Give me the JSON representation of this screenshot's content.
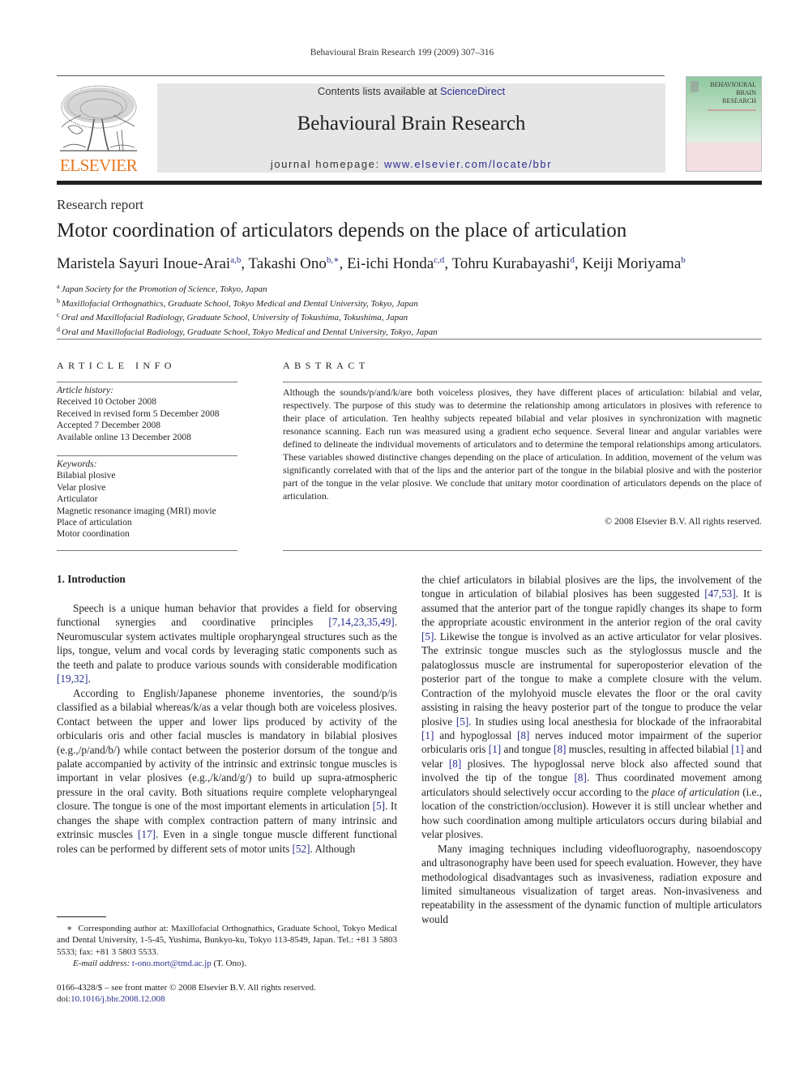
{
  "running_head": "Behavioural Brain Research 199 (2009) 307–316",
  "header": {
    "publisher_logo_text": "ELSEVIER",
    "contents_prefix": "Contents lists available at ",
    "contents_link": "ScienceDirect",
    "journal_name": "Behavioural Brain Research",
    "homepage_prefix": "journal homepage: ",
    "homepage_link": "www.elsevier.com/locate/bbr",
    "cover_title_lines": [
      "BEHAVIOURAL",
      "BRAIN",
      "RESEARCH"
    ],
    "colors": {
      "publisher_orange": "#e87722",
      "link_blue": "#2a2f8f",
      "banner_gray": "#e6e6e7"
    }
  },
  "article": {
    "type": "Research report",
    "title": "Motor coordination of articulators depends on the place of articulation",
    "authors": [
      {
        "name": "Maristela Sayuri Inoue-Arai",
        "sup": "a,b"
      },
      {
        "name": "Takashi Ono",
        "sup": "b,∗"
      },
      {
        "name": "Ei-ichi Honda",
        "sup": "c,d"
      },
      {
        "name": "Tohru Kurabayashi",
        "sup": "d"
      },
      {
        "name": "Keiji Moriyama",
        "sup": "b"
      }
    ],
    "affiliations": [
      {
        "key": "a",
        "text": "Japan Society for the Promotion of Science, Tokyo, Japan"
      },
      {
        "key": "b",
        "text": "Maxillofacial Orthognathics, Graduate School, Tokyo Medical and Dental University, Tokyo, Japan"
      },
      {
        "key": "c",
        "text": "Oral and Maxillofacial Radiology, Graduate School, University of Tokushima, Tokushima, Japan"
      },
      {
        "key": "d",
        "text": "Oral and Maxillofacial Radiology, Graduate School, Tokyo Medical and Dental University, Tokyo, Japan"
      }
    ]
  },
  "article_info": {
    "heading": "ARTICLE INFO",
    "history_label": "Article history:",
    "history": [
      "Received 10 October 2008",
      "Received in revised form 5 December 2008",
      "Accepted 7 December 2008",
      "Available online 13 December 2008"
    ],
    "keywords_label": "Keywords:",
    "keywords": [
      "Bilabial plosive",
      "Velar plosive",
      "Articulator",
      "Magnetic resonance imaging (MRI) movie",
      "Place of articulation",
      "Motor coordination"
    ]
  },
  "abstract": {
    "heading": "ABSTRACT",
    "text": "Although the sounds/p/and/k/are both voiceless plosives, they have different places of articulation: bilabial and velar, respectively. The purpose of this study was to determine the relationship among articulators in plosives with reference to their place of articulation. Ten healthy subjects repeated bilabial and velar plosives in synchronization with magnetic resonance scanning. Each run was measured using a gradient echo sequence. Several linear and angular variables were defined to delineate the individual movements of articulators and to determine the temporal relationships among articulators. These variables showed distinctive changes depending on the place of articulation. In addition, movement of the velum was significantly correlated with that of the lips and the anterior part of the tongue in the bilabial plosive and with the posterior part of the tongue in the velar plosive. We conclude that unitary motor coordination of articulators depends on the place of articulation.",
    "copyright": "© 2008 Elsevier B.V. All rights reserved."
  },
  "introduction": {
    "heading": "1.  Introduction",
    "left_column": [
      {
        "indent": true,
        "segments": [
          {
            "t": "Speech is a unique human behavior that provides a field for observing functional synergies and coordinative principles "
          },
          {
            "t": "[7,14,23,35,49]",
            "ref": true
          },
          {
            "t": ". Neuromuscular system activates multiple oropharyngeal structures such as the lips, tongue, velum and vocal cords by leveraging static components such as the teeth and palate to produce various sounds with considerable modification "
          },
          {
            "t": "[19,32]",
            "ref": true
          },
          {
            "t": "."
          }
        ]
      },
      {
        "indent": true,
        "segments": [
          {
            "t": "According to English/Japanese phoneme inventories, the sound/p/is classified as a bilabial whereas/k/as a velar though both are voiceless plosives. Contact between the upper and lower lips produced by activity of the orbicularis oris and other facial muscles is mandatory in bilabial plosives (e.g.,/p/and/b/) while contact between the posterior dorsum of the tongue and palate accompanied by activity of the intrinsic and extrinsic tongue muscles is important in velar plosives (e.g.,/k/and/g/) to build up supra-atmospheric pressure in the oral cavity. Both situations require complete velopharyngeal closure. The tongue is one of the most important elements in articulation "
          },
          {
            "t": "[5]",
            "ref": true
          },
          {
            "t": ". It changes the shape with complex contraction pattern of many intrinsic and extrinsic muscles "
          },
          {
            "t": "[17]",
            "ref": true
          },
          {
            "t": ". Even in a single tongue muscle different functional roles can be performed by different sets of motor units "
          },
          {
            "t": "[52]",
            "ref": true
          },
          {
            "t": ". Although"
          }
        ]
      }
    ],
    "right_column": [
      {
        "indent": false,
        "segments": [
          {
            "t": "the chief articulators in bilabial plosives are the lips, the involvement of the tongue in articulation of bilabial plosives has been suggested "
          },
          {
            "t": "[47,53]",
            "ref": true
          },
          {
            "t": ". It is assumed that the anterior part of the tongue rapidly changes its shape to form the appropriate acoustic environment in the anterior region of the oral cavity "
          },
          {
            "t": "[5]",
            "ref": true
          },
          {
            "t": ". Likewise the tongue is involved as an active articulator for velar plosives. The extrinsic tongue muscles such as the styloglossus muscle and the palatoglossus muscle are instrumental for superoposterior elevation of the posterior part of the tongue to make a complete closure with the velum. Contraction of the mylohyoid muscle elevates the floor or the oral cavity assisting in raising the heavy posterior part of the tongue to produce the velar plosive "
          },
          {
            "t": "[5]",
            "ref": true
          },
          {
            "t": ". In studies using local anesthesia for blockade of the infraorabital "
          },
          {
            "t": "[1]",
            "ref": true
          },
          {
            "t": " and hypoglossal "
          },
          {
            "t": "[8]",
            "ref": true
          },
          {
            "t": " nerves induced motor impairment of the superior orbicularis oris "
          },
          {
            "t": "[1]",
            "ref": true
          },
          {
            "t": " and tongue "
          },
          {
            "t": "[8]",
            "ref": true
          },
          {
            "t": " muscles, resulting in affected bilabial "
          },
          {
            "t": "[1]",
            "ref": true
          },
          {
            "t": " and velar "
          },
          {
            "t": "[8]",
            "ref": true
          },
          {
            "t": " plosives. The hypoglossal nerve block also affected sound that involved the tip of the tongue "
          },
          {
            "t": "[8]",
            "ref": true
          },
          {
            "t": ". Thus coordinated movement among articulators should selectively occur according to the "
          },
          {
            "t": "place of articulation",
            "italic": true
          },
          {
            "t": " (i.e., location of the constriction/occlusion). However it is still unclear whether and how such coordination among multiple articulators occurs during bilabial and velar plosives."
          }
        ]
      },
      {
        "indent": true,
        "segments": [
          {
            "t": "Many imaging techniques including videofluorography, nasoendoscopy and ultrasonography have been used for speech evaluation. However, they have methodological disadvantages such as invasiveness, radiation exposure and limited simultaneous visualization of target areas. Non-invasiveness and repeatability in the assessment of the dynamic function of multiple articulators would"
          }
        ]
      }
    ]
  },
  "footnote": {
    "marker": "∗",
    "corresponding": "Corresponding author at: Maxillofacial Orthognathics, Graduate School, Tokyo Medical and Dental University, 1-5-45, Yushima, Bunkyo-ku, Tokyo 113-8549, Japan. Tel.: +81 3 5803 5533; fax: +81 3 5803 5533.",
    "email_label": "E-mail address:",
    "email": "t-ono.mort@tmd.ac.jp",
    "email_suffix": " (T. Ono)."
  },
  "front_matter": {
    "issn_line": "0166-4328/$ – see front matter © 2008 Elsevier B.V. All rights reserved.",
    "doi_prefix": "doi:",
    "doi": "10.1016/j.bbr.2008.12.008"
  }
}
